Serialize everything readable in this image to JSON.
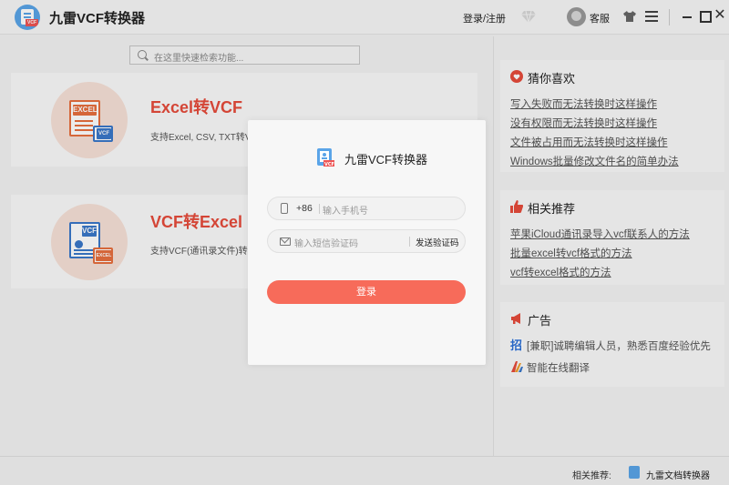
{
  "titlebar": {
    "app_title": "九雷VCF转换器",
    "login_link": "登录/注册",
    "service": "客服"
  },
  "search": {
    "placeholder": "在这里快速检索功能..."
  },
  "cards": [
    {
      "title": "Excel转VCF",
      "desc": "支持Excel, CSV, TXT转V",
      "icon_label": "EXCEL",
      "badge": "VCF"
    },
    {
      "title": "VCF转Excel",
      "desc": "支持VCF(通讯录文件)转换",
      "icon_label": "VCF",
      "badge": "EXCEL"
    }
  ],
  "right_panel": {
    "favorites": {
      "title": "猜你喜欢",
      "links": [
        "写入失败而无法转换时这样操作",
        "没有权限而无法转换时这样操作",
        "文件被占用而无法转换时这样操作",
        "Windows批量修改文件名的简单办法"
      ]
    },
    "recommend": {
      "title": "相关推荐",
      "links": [
        "苹果iCloud通讯录导入vcf联系人的方法",
        "批量excel转vcf格式的方法",
        "vcf转excel格式的方法"
      ]
    },
    "ads": {
      "title": "广告",
      "items": [
        "[兼职]诚聘编辑人员，熟悉百度经验优先",
        "智能在线翻译"
      ]
    }
  },
  "footer": {
    "label": "相关推荐:",
    "app": "九雷文档转换器"
  },
  "modal": {
    "title": "九雷VCF转换器",
    "country_code": "+86",
    "phone_placeholder": "输入手机号",
    "code_placeholder": "输入短信验证码",
    "send_code": "发送验证码",
    "login_button": "登录"
  },
  "colors": {
    "accent": "#e64b3b",
    "login_button": "#f76b5a",
    "brand_blue": "#5aa4e8"
  }
}
